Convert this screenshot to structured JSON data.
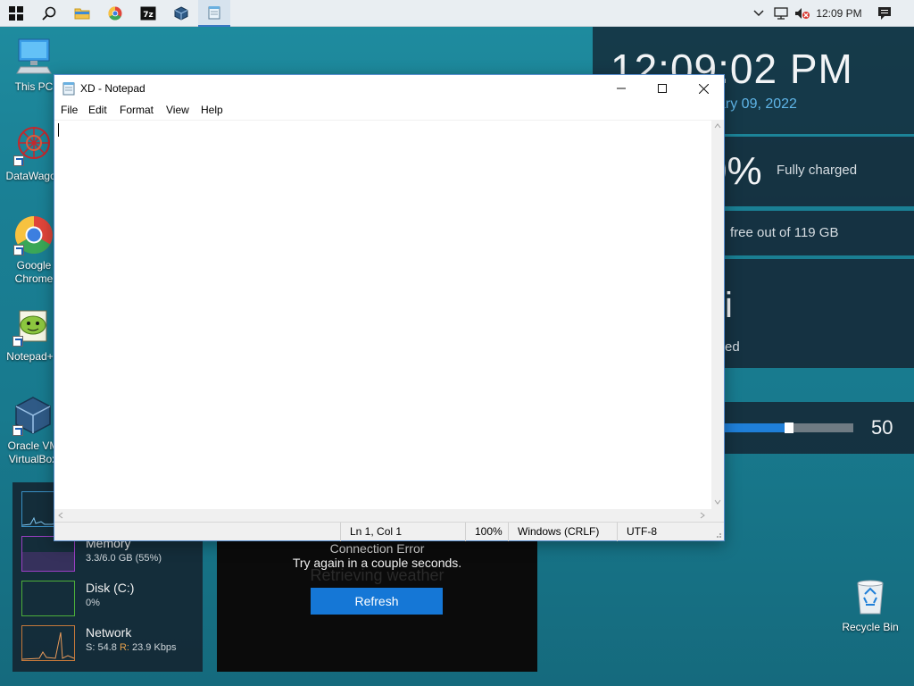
{
  "taskbar": {
    "time": "12:09 PM",
    "pinned": [
      "start",
      "search",
      "file-explorer",
      "chrome",
      "7zip",
      "virtualbox",
      "notepad"
    ]
  },
  "desktop_icons": [
    {
      "label": "This PC",
      "icon": "this-pc-icon"
    },
    {
      "label": "DataWagon",
      "icon": "datawagon-icon"
    },
    {
      "label": "Google Chrome",
      "icon": "chrome-icon"
    },
    {
      "label": "Notepad++",
      "icon": "notepadpp-icon"
    },
    {
      "label": "Oracle VM VirtualBox",
      "icon": "virtualbox-icon"
    }
  ],
  "widgets": {
    "clock_time": "12:09:02 PM",
    "clock_date": "ary 09, 2022",
    "battery_percent": "0%",
    "battery_status": "Fully charged",
    "disk": "free out of 119 GB",
    "wifi_name": "i",
    "wifi_status": "ed",
    "volume": "50",
    "volume_level": 0.5
  },
  "system_monitor": {
    "memory_label": "Memory",
    "memory_value": "3.3/6.0 GB (55%)",
    "disk_label": "Disk (C:)",
    "disk_value": "0%",
    "network_label": "Network",
    "network_send_label": "S:",
    "network_send_value": "54.8",
    "network_recv_label": "R:",
    "network_recv_value": "23.9 Kbps"
  },
  "weather": {
    "ghost_title": "Retrieving weather",
    "error_title": "Connection Error",
    "message": "Try again in a couple seconds.",
    "refresh_label": "Refresh"
  },
  "recycle_bin": {
    "label": "Recycle Bin"
  },
  "notepad": {
    "title": "XD - Notepad",
    "menu": [
      "File",
      "Edit",
      "Format",
      "View",
      "Help"
    ],
    "content": "",
    "status": {
      "position": "Ln 1, Col 1",
      "zoom": "100%",
      "line_ending": "Windows (CRLF)",
      "encoding": "UTF-8"
    }
  },
  "colors": {
    "accent": "#1577d6",
    "date_blue": "#5fb5e8",
    "desktop_teal": "#1a7f94"
  }
}
